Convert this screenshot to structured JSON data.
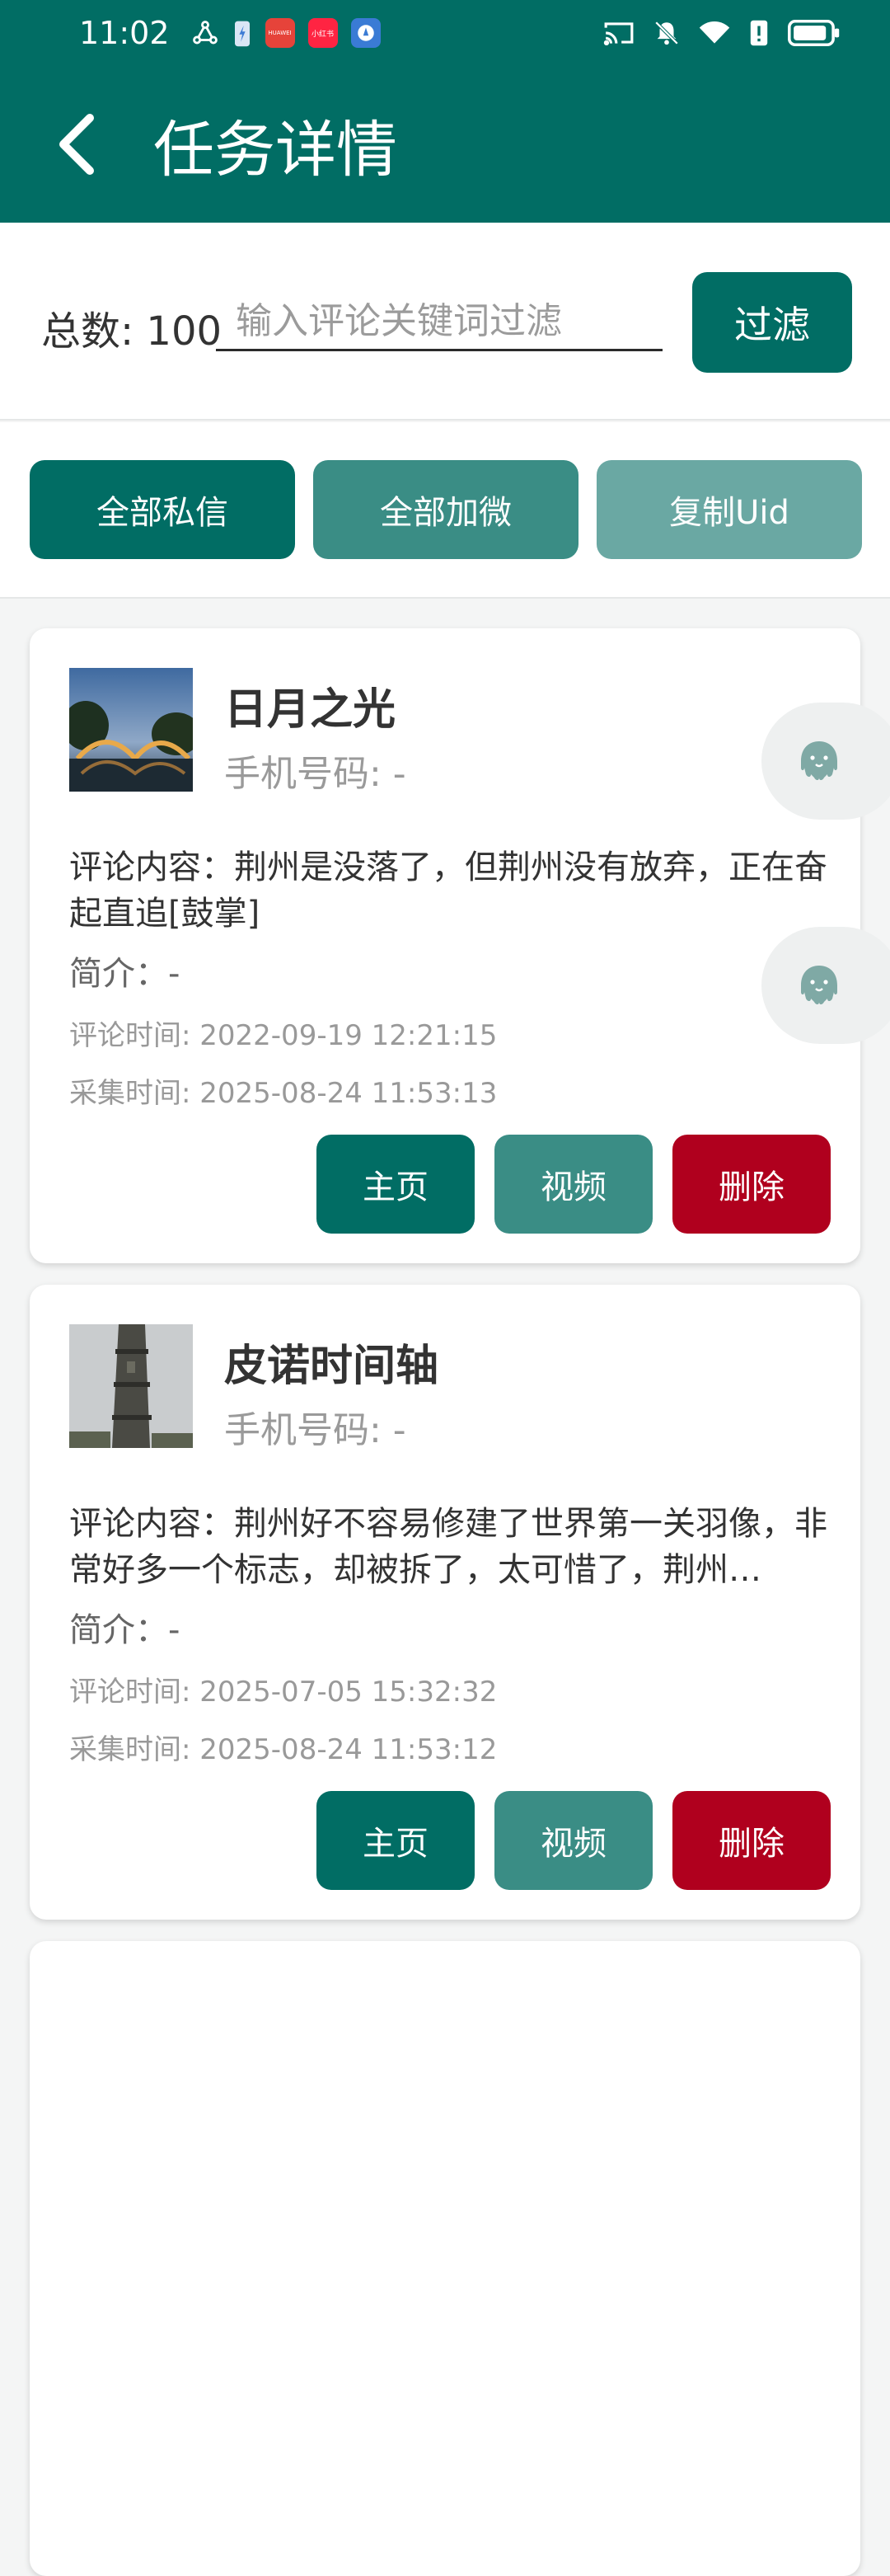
{
  "status": {
    "time": "11:02",
    "app_badges": [
      "HUAWEI",
      "小红书"
    ]
  },
  "appbar": {
    "title": "任务详情"
  },
  "filter": {
    "total_label": "总数: 100",
    "placeholder": "输入评论关键词过滤",
    "button": "过滤"
  },
  "actions": {
    "dm_all": "全部私信",
    "wechat_all": "全部加微",
    "copy_uid": "复制Uid"
  },
  "colors": {
    "primary": "#016d64",
    "secondary": "#3a8d85",
    "disabled": "#6aa8a3",
    "danger": "#b0001e"
  },
  "cards": [
    {
      "name": "日月之光",
      "phone": "手机号码: -",
      "comment": "评论内容：荆州是没落了，但荆州没有放弃，正在奋起直追[鼓掌]",
      "intro": "简介：-",
      "comment_time": "评论时间: 2022-09-19 12:21:15",
      "collect_time": "采集时间: 2025-08-24 11:53:13",
      "btn_home": "主页",
      "btn_video": "视频",
      "btn_delete": "删除"
    },
    {
      "name": "皮诺时间轴",
      "phone": "手机号码: -",
      "comment": "评论内容：荆州好不容易修建了世界第一关羽像，非常好多一个标志，却被拆了，太可惜了，荆州…",
      "intro": "简介：-",
      "comment_time": "评论时间: 2025-07-05 15:32:32",
      "collect_time": "采集时间: 2025-08-24 11:53:12",
      "btn_home": "主页",
      "btn_video": "视频",
      "btn_delete": "删除"
    }
  ]
}
